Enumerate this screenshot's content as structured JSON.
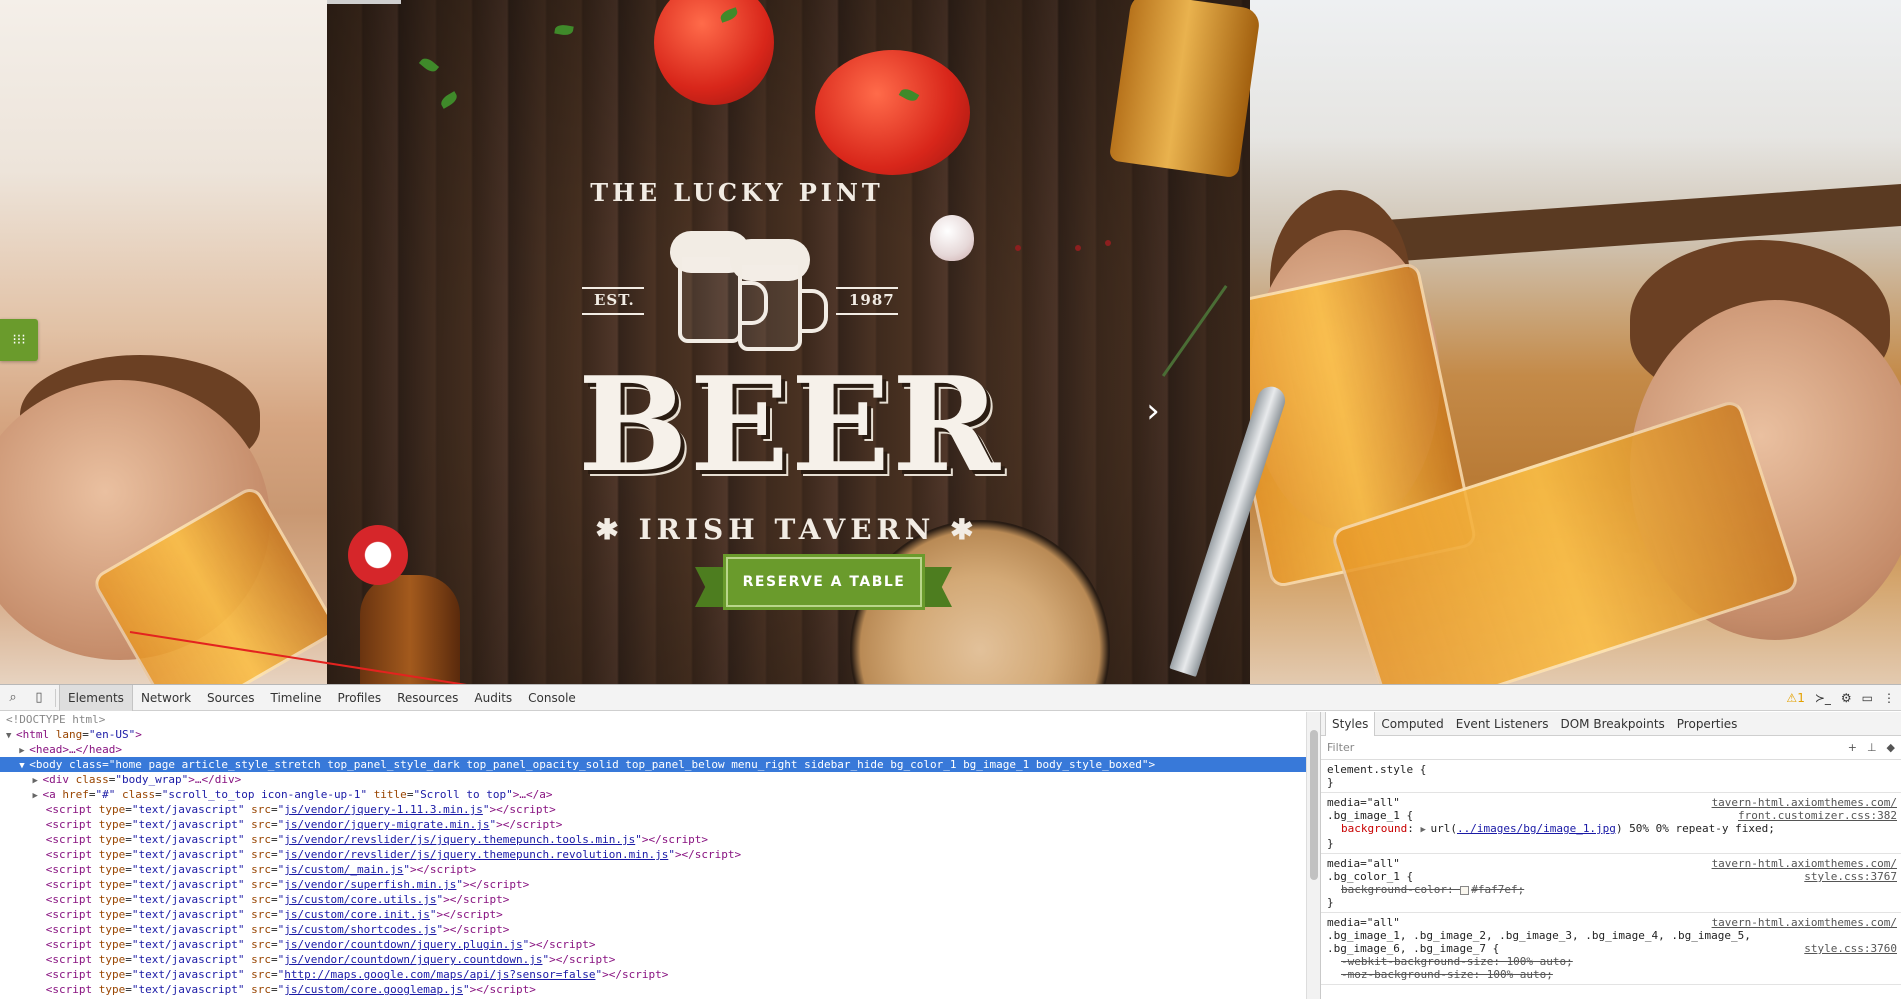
{
  "hero": {
    "logo_top": "THE LUCKY PINT",
    "est_label": "EST.",
    "year_label": "1987",
    "logo_main": "BEER",
    "logo_sub": "✱ IRISH TAVERN ✱",
    "reserve_button": "RESERVE A TABLE",
    "slider_next_icon": "chevron-right-icon",
    "side_tab_icon": "palette-icon"
  },
  "devtools": {
    "toolbar": {
      "search_icon": "magnifier-icon",
      "device_icon": "mobile-device-icon",
      "tabs": [
        "Elements",
        "Network",
        "Sources",
        "Timeline",
        "Profiles",
        "Resources",
        "Audits",
        "Console"
      ],
      "active_tab": "Elements",
      "warning_count": "1",
      "icons": [
        "console-drawer-icon",
        "gear-icon",
        "dock-icon",
        "close-icon"
      ]
    },
    "dom": {
      "doctype": "<!DOCTYPE html>",
      "html_open": {
        "tag": "html",
        "attr": "lang",
        "val": "en-US"
      },
      "head": "<head>…</head>",
      "body_class": "home page article_style_stretch top_panel_style_dark top_panel_opacity_solid top_panel_below menu_right sidebar_hide bg_color_1 bg_image_1 body_style_boxed",
      "body_wrap_class": "body_wrap",
      "scroll_top": {
        "href": "#",
        "class": "scroll_to_top icon-angle-up-1",
        "title": "Scroll to top"
      },
      "script_type": "text/javascript",
      "scripts": [
        "js/vendor/jquery-1.11.3.min.js",
        "js/vendor/jquery-migrate.min.js",
        "js/vendor/revslider/js/jquery.themepunch.tools.min.js",
        "js/vendor/revslider/js/jquery.themepunch.revolution.min.js",
        "js/custom/_main.js",
        "js/vendor/superfish.min.js",
        "js/custom/core.utils.js",
        "js/custom/core.init.js",
        "js/custom/shortcodes.js",
        "js/vendor/countdown/jquery.plugin.js",
        "js/vendor/countdown/jquery.countdown.js",
        "http://maps.google.com/maps/api/js?sensor=false",
        "js/custom/core.googlemap.js"
      ]
    },
    "styles": {
      "tabs": [
        "Styles",
        "Computed",
        "Event Listeners",
        "DOM Breakpoints",
        "Properties"
      ],
      "active_tab": "Styles",
      "filter_placeholder": "Filter",
      "element_style": "element.style {",
      "rules": [
        {
          "media": "media=\"all\"",
          "src1": "tavern-html.axiomthemes.com/",
          "src2": "front.customizer.css:382",
          "selector": ".bg_image_1 {",
          "prop": "background",
          "value_pre": "url(",
          "value_link": "../images/bg/image_1.jpg",
          "value_post": ") 50% 0% repeat-y fixed;"
        },
        {
          "media": "media=\"all\"",
          "src1": "tavern-html.axiomthemes.com/",
          "src2": "style.css:3767",
          "selector": ".bg_color_1 {",
          "prop": "background-color",
          "value": "#faf7ef;",
          "swatch": "#faf7ef"
        },
        {
          "media": "media=\"all\"",
          "src1": "tavern-html.axiomthemes.com/",
          "src2": "style.css:3760",
          "selector1": ".bg_image_1, .bg_image_2, .bg_image_3, .bg_image_4, .bg_image_5,",
          "selector2": ".bg_image_6, .bg_image_7 {",
          "prop1": "-webkit-background-size: 100% auto;",
          "prop2": "-moz-background-size: 100% auto;"
        }
      ]
    }
  }
}
